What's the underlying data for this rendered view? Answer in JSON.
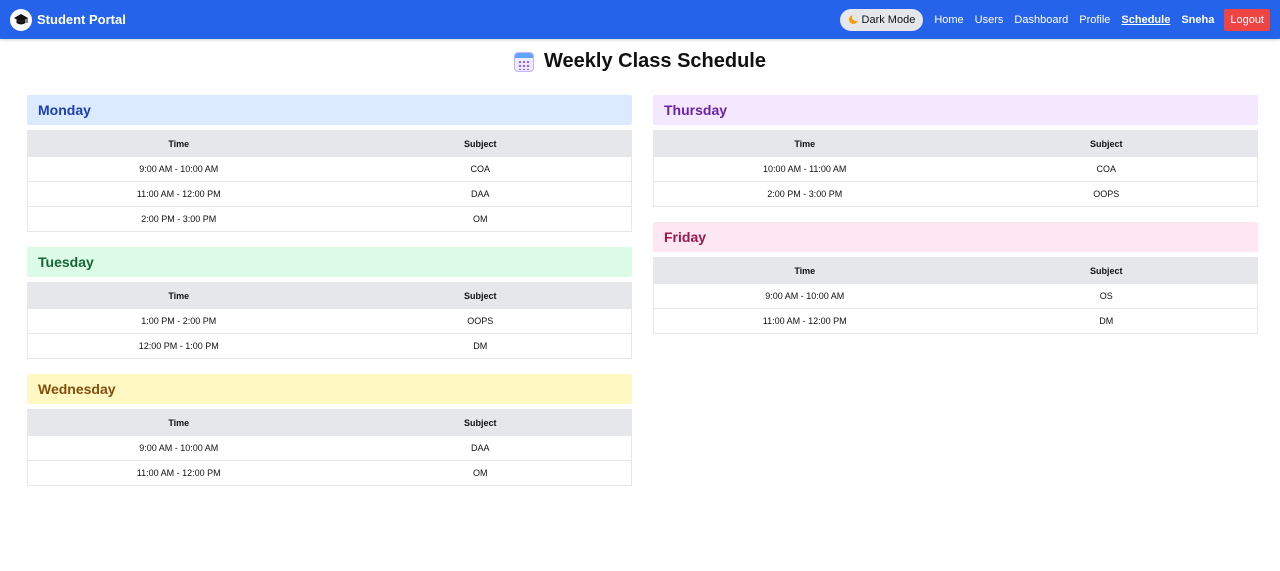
{
  "navbar": {
    "brand": "Student Portal",
    "dark_mode_label": "Dark Mode",
    "links": [
      "Home",
      "Users",
      "Dashboard",
      "Profile",
      "Schedule"
    ],
    "active_link": "Schedule",
    "user": "Sneha",
    "logout_label": "Logout",
    "bg_color": "#2563eb"
  },
  "page": {
    "title": "Weekly Class Schedule"
  },
  "table_headers": {
    "time": "Time",
    "subject": "Subject"
  },
  "days": [
    {
      "name": "Monday",
      "header_bg": "#dbeafe",
      "header_color": "#1e40af",
      "rows": [
        [
          "9:00 AM - 10:00 AM",
          "COA"
        ],
        [
          "11:00 AM - 12:00 PM",
          "DAA"
        ],
        [
          "2:00 PM - 3:00 PM",
          "OM"
        ]
      ]
    },
    {
      "name": "Tuesday",
      "header_bg": "#dcfce7",
      "header_color": "#166534",
      "rows": [
        [
          "1:00 PM - 2:00 PM",
          "OOPS"
        ],
        [
          "12:00 PM - 1:00 PM",
          "DM"
        ]
      ]
    },
    {
      "name": "Wednesday",
      "header_bg": "#fef9c3",
      "header_color": "#854d0e",
      "rows": [
        [
          "9:00 AM - 10:00 AM",
          "DAA"
        ],
        [
          "11:00 AM - 12:00 PM",
          "OM"
        ]
      ]
    },
    {
      "name": "Thursday",
      "header_bg": "#f3e8ff",
      "header_color": "#6b21a8",
      "rows": [
        [
          "10:00 AM - 11:00 AM",
          "COA"
        ],
        [
          "2:00 PM - 3:00 PM",
          "OOPS"
        ]
      ]
    },
    {
      "name": "Friday",
      "header_bg": "#fce7f3",
      "header_color": "#9d174d",
      "rows": [
        [
          "9:00 AM - 10:00 AM",
          "OS"
        ],
        [
          "11:00 AM - 12:00 PM",
          "DM"
        ]
      ]
    }
  ]
}
